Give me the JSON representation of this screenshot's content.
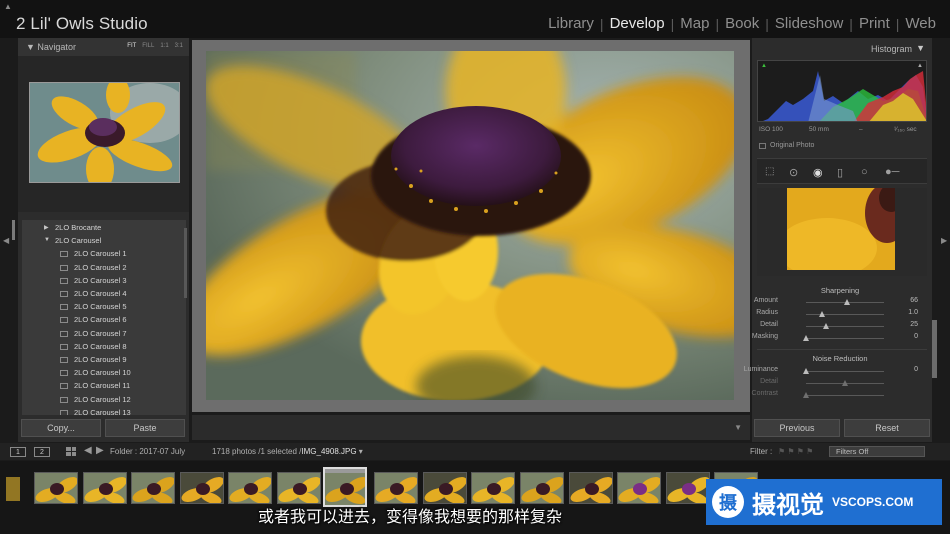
{
  "app": {
    "title": "2 Lil' Owls Studio",
    "modules": [
      "Library",
      "Develop",
      "Map",
      "Book",
      "Slideshow",
      "Print",
      "Web"
    ],
    "active_module": "Develop"
  },
  "navigator": {
    "title": "Navigator",
    "zoom_options": [
      "FIT",
      "FILL",
      "1:1",
      "3:1"
    ]
  },
  "folders": {
    "parents": [
      {
        "label": "2LO Brocante",
        "expanded": false
      },
      {
        "label": "2LO Carousel",
        "expanded": true
      }
    ],
    "children": [
      "2LO Carousel 1",
      "2LO Carousel 2",
      "2LO Carousel 3",
      "2LO Carousel 4",
      "2LO Carousel 5",
      "2LO Carousel 6",
      "2LO Carousel 7",
      "2LO Carousel 8",
      "2LO Carousel 9",
      "2LO Carousel 10",
      "2LO Carousel 11",
      "2LO Carousel 12",
      "2LO Carousel 13"
    ]
  },
  "left_buttons": {
    "copy": "Copy...",
    "paste": "Paste"
  },
  "histogram": {
    "title": "Histogram",
    "iso": "ISO 100",
    "focal": "50 mm",
    "aperture": "–",
    "shutter": "¹⁄₁₆₀ sec",
    "original_photo": "Original Photo"
  },
  "sharpening": {
    "title": "Sharpening",
    "rows": [
      {
        "label": "Amount",
        "value": "66",
        "level": 0.52
      },
      {
        "label": "Radius",
        "value": "1.0",
        "level": 0.2
      },
      {
        "label": "Detail",
        "value": "25",
        "level": 0.25
      },
      {
        "label": "Masking",
        "value": "0",
        "level": 0.0
      }
    ]
  },
  "noise_reduction": {
    "title": "Noise Reduction",
    "rows": [
      {
        "label": "Luminance",
        "value": "0",
        "level": 0.0,
        "dim": false
      },
      {
        "label": "Detail",
        "value": "",
        "level": 0.5,
        "dim": true
      },
      {
        "label": "Contrast",
        "value": "",
        "level": 0.0,
        "dim": true
      }
    ]
  },
  "right_buttons": {
    "previous": "Previous",
    "reset": "Reset"
  },
  "filmstrip": {
    "pages": [
      "1",
      "2"
    ],
    "folder": "Folder : 2017-07 July",
    "count_text": "1718 photos /1 selected /",
    "filename": "IMG_4908.JPG",
    "filter_label": "Filter :",
    "filter_value": "Filters Off",
    "selected_index": 6
  },
  "subtitle": "或者我可以进去，变得像我想要的那样复杂",
  "watermark": {
    "glyph": "摄",
    "text": "摄视觉",
    "site": "VSCOPS.COM"
  },
  "colors": {
    "accent": "#1f6fd1",
    "petal": "#e6ad22",
    "center": "#4a2450"
  }
}
